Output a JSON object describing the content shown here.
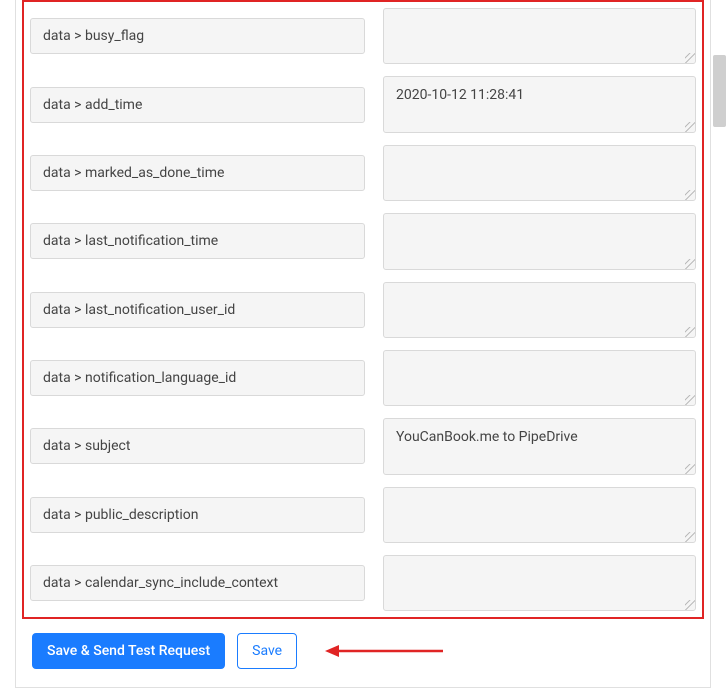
{
  "fields": [
    {
      "label": "data > busy_flag",
      "value": ""
    },
    {
      "label": "data > add_time",
      "value": "2020-10-12 11:28:41"
    },
    {
      "label": "data > marked_as_done_time",
      "value": ""
    },
    {
      "label": "data > last_notification_time",
      "value": ""
    },
    {
      "label": "data > last_notification_user_id",
      "value": ""
    },
    {
      "label": "data > notification_language_id",
      "value": ""
    },
    {
      "label": "data > subject",
      "value": "YouCanBook.me to PipeDrive"
    },
    {
      "label": "data > public_description",
      "value": ""
    },
    {
      "label": "data > calendar_sync_include_context",
      "value": ""
    }
  ],
  "buttons": {
    "save_send_label": "Save & Send Test Request",
    "save_label": "Save"
  },
  "annotation_color": "#e02424"
}
